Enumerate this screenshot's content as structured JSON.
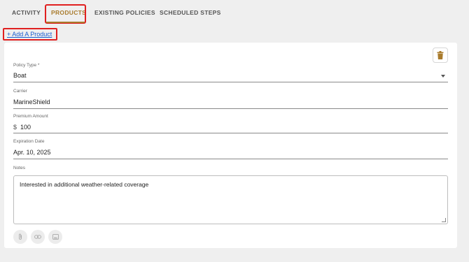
{
  "tabs": {
    "activity": "ACTIVITY",
    "products": "PRODUCTS",
    "existing_policies": "EXISTING POLICIES",
    "scheduled_steps": "SCHEDULED STEPS",
    "active": "PRODUCTS"
  },
  "add_product_label": "+ Add A Product",
  "form": {
    "policy_type": {
      "label": "Policy Type *",
      "value": "Boat"
    },
    "carrier": {
      "label": "Carrier",
      "value": "MarineShield"
    },
    "premium_amount": {
      "label": "Premium Amount",
      "currency": "$",
      "value": "100"
    },
    "expiration_date": {
      "label": "Expiration Date",
      "value": "Apr. 10, 2025"
    },
    "notes": {
      "label": "Notes",
      "value": "Interested in additional weather-related coverage"
    }
  },
  "icons": {
    "delete": "trash-icon",
    "attach": "paperclip-icon",
    "link": "link-icon",
    "image": "image-icon"
  },
  "colors": {
    "accent": "#a97b2c",
    "highlight": "#e02020",
    "link": "#1a5fd0"
  }
}
